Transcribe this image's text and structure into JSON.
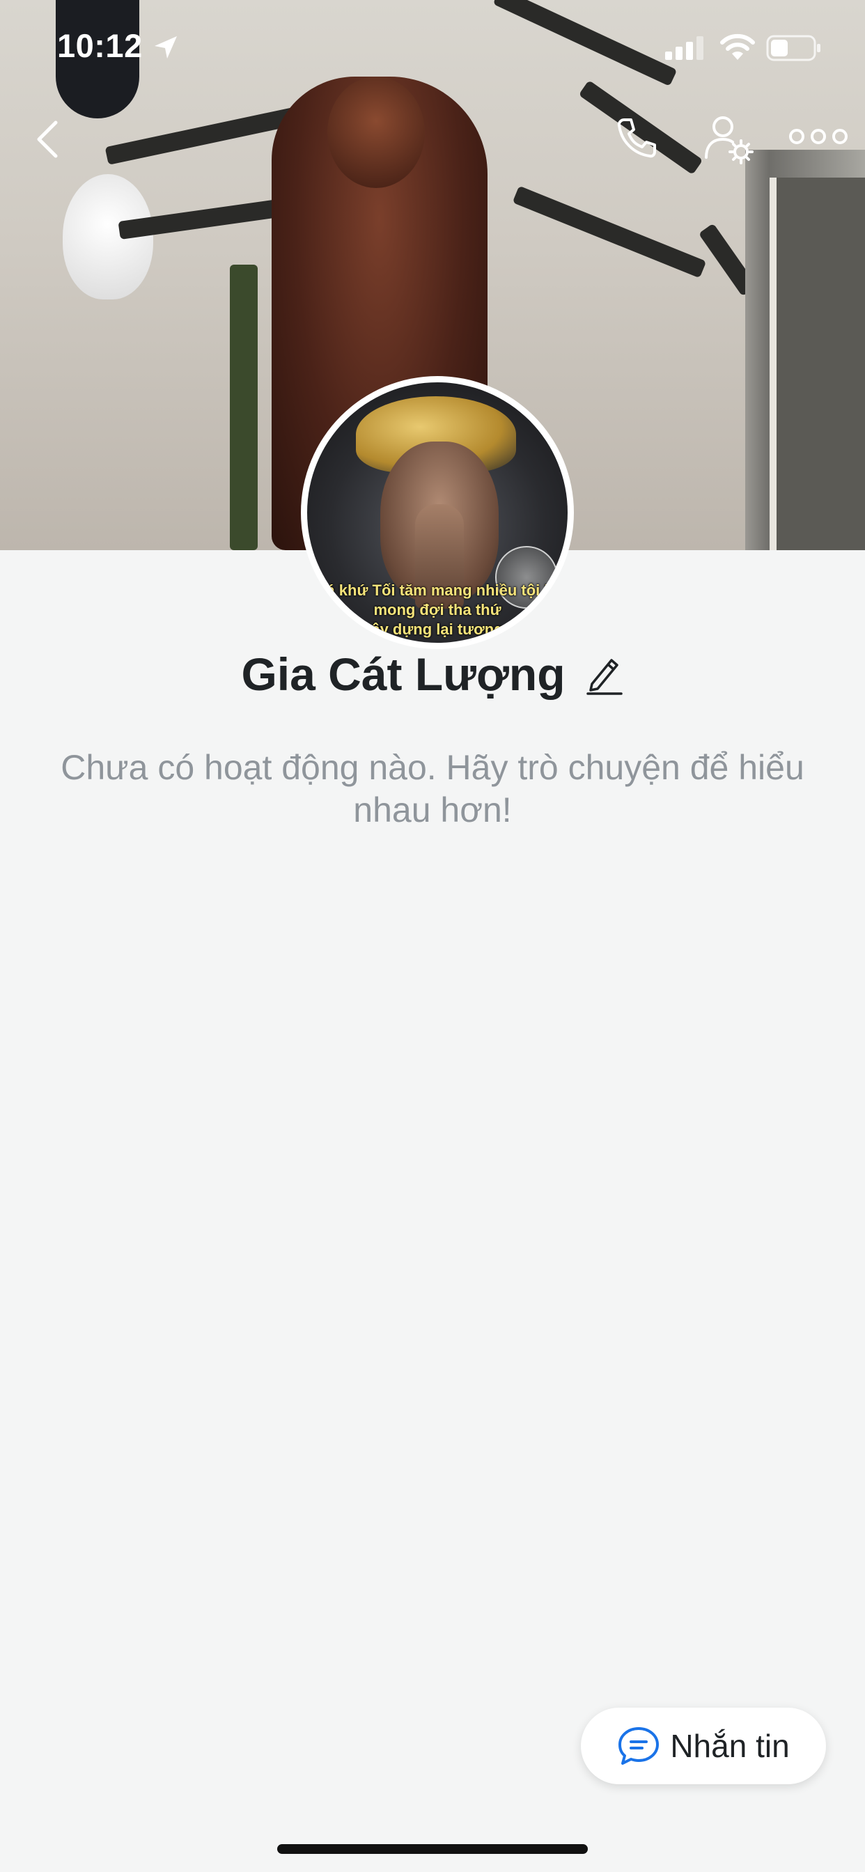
{
  "status_bar": {
    "time": "10:12"
  },
  "profile": {
    "name": "Gia Cát Lượng",
    "empty_message": "Chưa có hoạt động nào. Hãy trò chuyện để hiểu nhau hơn!",
    "avatar_caption": [
      "á khứ Tối tăm mang nhiều tội l",
      "mong đợi tha thứ",
      "ây dựng lại tương"
    ]
  },
  "actions": {
    "message_label": "Nhắn tin"
  },
  "icons": {
    "back": "chevron-left-icon",
    "call": "phone-icon",
    "settings": "user-settings-icon",
    "more": "more-horizontal-icon",
    "edit": "pencil-icon",
    "message": "chat-bubble-icon"
  },
  "colors": {
    "accent": "#1a73e8",
    "background": "#f4f5f5",
    "text": "#1f2326",
    "muted": "#8f959b"
  }
}
